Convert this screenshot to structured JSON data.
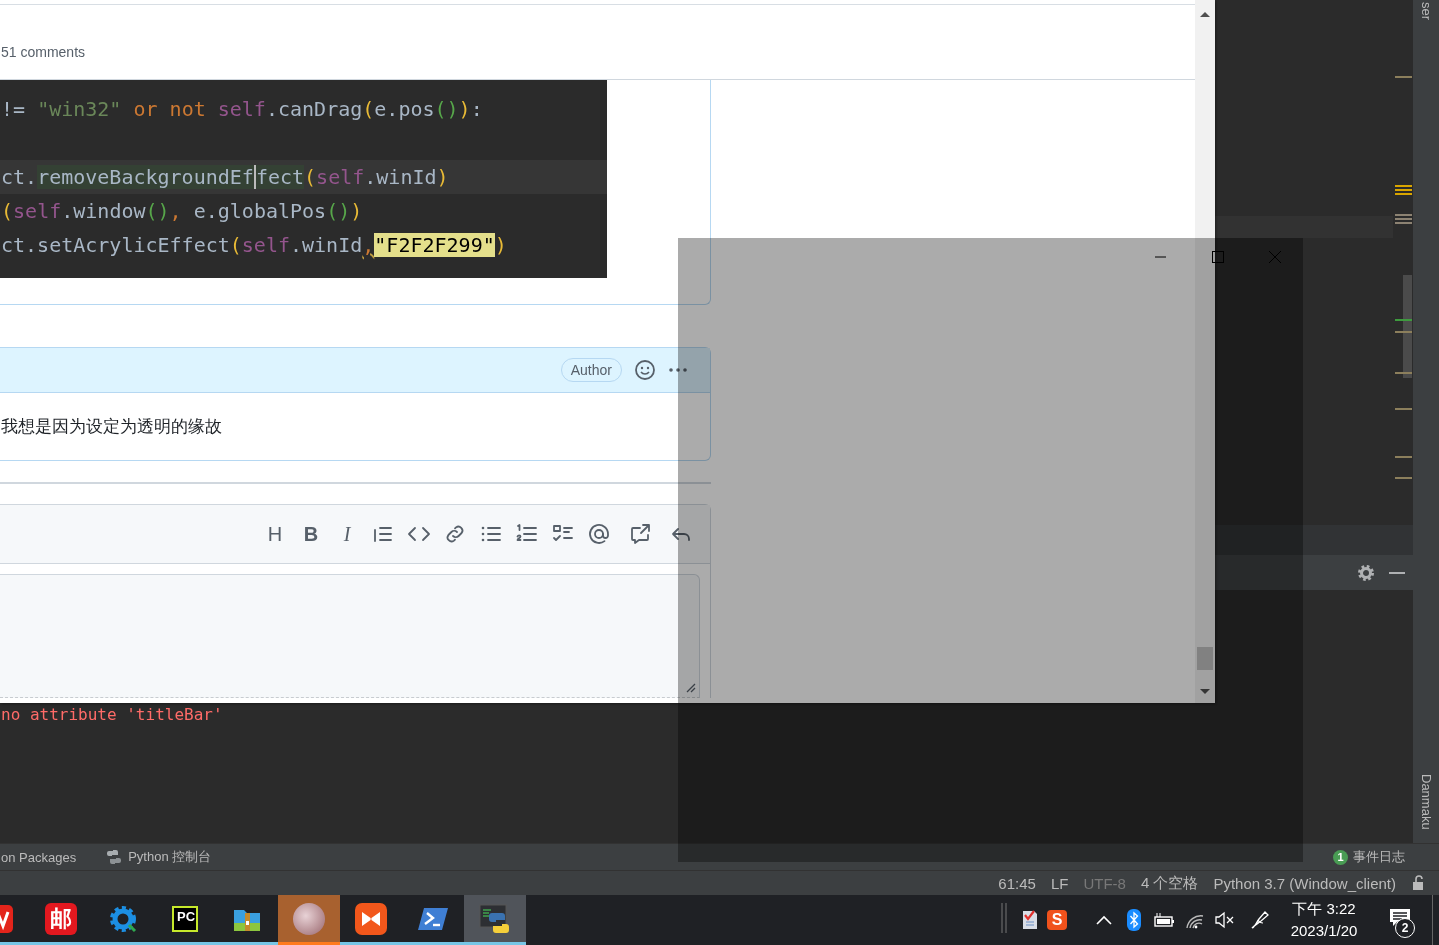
{
  "browser": {
    "comment_count": "51 comments",
    "code_lines": [
      {
        "kind": "code",
        "tokens": [
          {
            "t": "!= ",
            "kind": "plain"
          },
          {
            "t": "\"win32\"",
            "kind": "string"
          },
          {
            "t": " or not ",
            "kind": "keyword"
          },
          {
            "t": "self",
            "kind": "self"
          },
          {
            "t": ".canDrag",
            "kind": "plain"
          },
          {
            "t": "(",
            "kind": "paren1"
          },
          {
            "t": "e.pos",
            "kind": "plain"
          },
          {
            "t": "()",
            "kind": "paren2"
          },
          {
            "t": ")",
            "kind": "paren1"
          },
          {
            "t": ":",
            "kind": "plain"
          }
        ]
      },
      {
        "kind": "blank"
      },
      {
        "kind": "current",
        "tokens": [
          {
            "t": "ct.",
            "kind": "plain"
          },
          {
            "t": "removeBackgroundEf",
            "kind": "match",
            "caret": true
          },
          {
            "t": "fect",
            "kind": "match",
            "caret": false
          },
          {
            "t": "(",
            "kind": "paren1"
          },
          {
            "t": "self",
            "kind": "self"
          },
          {
            "t": ".winId",
            "kind": "plain"
          },
          {
            "t": ")",
            "kind": "paren1"
          }
        ]
      },
      {
        "kind": "code",
        "tokens": [
          {
            "t": "(",
            "kind": "paren1"
          },
          {
            "t": "self",
            "kind": "self"
          },
          {
            "t": ".window",
            "kind": "plain"
          },
          {
            "t": "()",
            "kind": "paren2"
          },
          {
            "t": ", ",
            "kind": "keyword"
          },
          {
            "t": "e.globalPos",
            "kind": "plain"
          },
          {
            "t": "()",
            "kind": "paren2"
          },
          {
            "t": ")",
            "kind": "paren1"
          }
        ]
      },
      {
        "kind": "code",
        "tokens": [
          {
            "t": "ct.setAcrylicEffect",
            "kind": "plain"
          },
          {
            "t": "(",
            "kind": "paren1"
          },
          {
            "t": "self",
            "kind": "self"
          },
          {
            "t": ".winId",
            "kind": "plain"
          },
          {
            "t": ",",
            "kind": "warn"
          },
          {
            "t": "\"F2F2F299\"",
            "kind": "search"
          },
          {
            "t": ")",
            "kind": "paren1"
          }
        ]
      }
    ],
    "comment": {
      "badge": "Author",
      "body": "我想是因为设定为透明的缘故"
    },
    "editor_toolbar": [
      {
        "kind": "heading",
        "glyph": "H"
      },
      {
        "kind": "bold",
        "glyph": "B"
      },
      {
        "kind": "italic",
        "glyph": "I"
      },
      {
        "kind": "quote"
      },
      {
        "kind": "code"
      },
      {
        "kind": "link"
      },
      {
        "kind": "bullet-list"
      },
      {
        "kind": "numbered-list"
      },
      {
        "kind": "task-list"
      },
      {
        "kind": "mention"
      },
      {
        "kind": "reference"
      },
      {
        "kind": "reply"
      }
    ]
  },
  "ide": {
    "side_tabs": [
      "ser",
      "Danmaku"
    ],
    "console_error": "no attribute 'titleBar'",
    "tool_tabs": [
      {
        "label": "on Packages",
        "kind": "plain"
      },
      {
        "label": "Python 控制台",
        "kind": "python"
      }
    ],
    "event_log": {
      "count": "1",
      "label": "事件日志"
    },
    "status_bar": [
      {
        "text": "61:45",
        "dimmed": false
      },
      {
        "text": "LF",
        "dimmed": false
      },
      {
        "text": "UTF-8",
        "dimmed": true
      },
      {
        "text": "4 个空格",
        "dimmed": false
      },
      {
        "text": "Python 3.7 (Window_client)",
        "dimmed": false
      }
    ]
  },
  "taskbar": {
    "apps": [
      {
        "kind": "wps",
        "running": true,
        "flashing": false,
        "selected": false
      },
      {
        "kind": "mail",
        "glyph": "邮",
        "running": true,
        "flashing": false,
        "selected": false
      },
      {
        "kind": "tool",
        "running": true,
        "flashing": false,
        "selected": false
      },
      {
        "kind": "ide",
        "glyph": "PC",
        "running": true,
        "flashing": false,
        "selected": false
      },
      {
        "kind": "archive",
        "running": true,
        "flashing": false,
        "selected": false
      },
      {
        "kind": "avatar",
        "running": true,
        "flashing": true,
        "selected": false
      },
      {
        "kind": "player",
        "running": true,
        "flashing": false,
        "selected": false
      },
      {
        "kind": "shell",
        "running": true,
        "flashing": false,
        "selected": false
      },
      {
        "kind": "python",
        "running": true,
        "flashing": false,
        "selected": true
      }
    ],
    "tray_logo": "S",
    "clock": {
      "time": "下午 3:22",
      "date": "2023/1/20"
    },
    "notification_count": "2"
  }
}
